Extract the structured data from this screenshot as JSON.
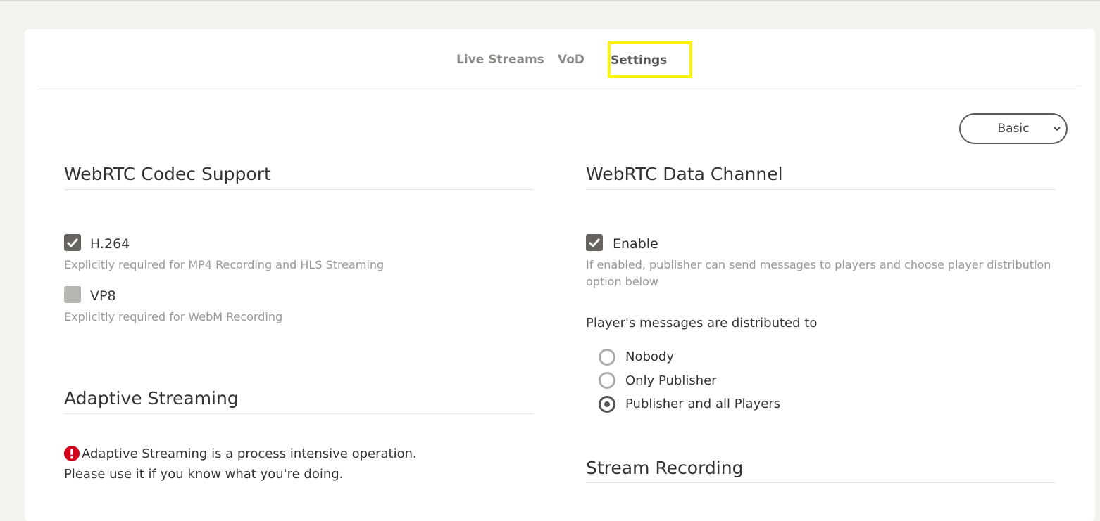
{
  "tabs": [
    {
      "label": "Live Streams",
      "active": false
    },
    {
      "label": "VoD",
      "active": false
    },
    {
      "label": "Settings",
      "active": true
    }
  ],
  "mode_select": {
    "value": "Basic"
  },
  "codec": {
    "title": "WebRTC Codec Support",
    "h264": {
      "label": "H.264",
      "checked": true,
      "help": "Explicitly required for MP4 Recording and HLS Streaming"
    },
    "vp8": {
      "label": "VP8",
      "checked": false,
      "help": "Explicitly required for WebM Recording"
    }
  },
  "adaptive": {
    "title": "Adaptive Streaming",
    "warning": "Adaptive Streaming is a process intensive operation. Please use it if you know what you're doing."
  },
  "data_channel": {
    "title": "WebRTC Data Channel",
    "enable": {
      "label": "Enable",
      "checked": true
    },
    "help": "If enabled, publisher can send messages to players and choose player distribution option below",
    "distribution_label": "Player's messages are distributed to",
    "options": [
      {
        "label": "Nobody",
        "selected": false
      },
      {
        "label": "Only Publisher",
        "selected": false
      },
      {
        "label": "Publisher and all Players",
        "selected": true
      }
    ]
  },
  "recording": {
    "title": "Stream Recording"
  },
  "colors": {
    "highlight": "#fbf20f",
    "warning": "#d0021b",
    "checkbox": "#676460"
  }
}
